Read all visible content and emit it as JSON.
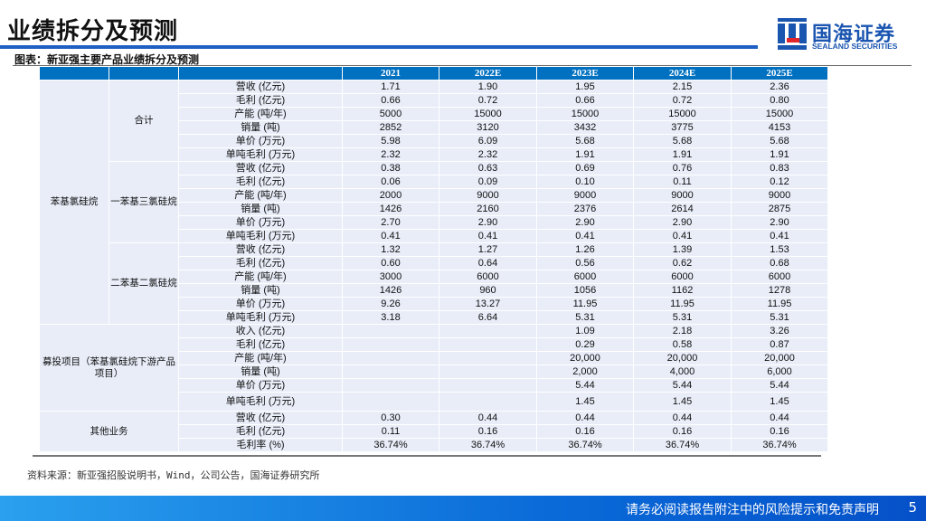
{
  "title": "业绩拆分及预测",
  "logo": {
    "cn": "国海证券",
    "en": "SEALAND SECURITIES"
  },
  "caption": "图表：新亚强主要产品业绩拆分及预测",
  "table": {
    "headers": [
      "",
      "",
      "",
      "2021",
      "2022E",
      "2023E",
      "2024E",
      "2025E"
    ],
    "groups": [
      {
        "name": "苯基氯硅烷",
        "subgroups": [
          {
            "name": "合计",
            "rows": [
              [
                "营收 (亿元)",
                "1.71",
                "1.90",
                "1.95",
                "2.15",
                "2.36"
              ],
              [
                "毛利 (亿元)",
                "0.66",
                "0.72",
                "0.66",
                "0.72",
                "0.80"
              ],
              [
                "产能 (吨/年)",
                "5000",
                "15000",
                "15000",
                "15000",
                "15000"
              ],
              [
                "销量 (吨)",
                "2852",
                "3120",
                "3432",
                "3775",
                "4153"
              ],
              [
                "单价 (万元)",
                "5.98",
                "6.09",
                "5.68",
                "5.68",
                "5.68"
              ],
              [
                "单吨毛利 (万元)",
                "2.32",
                "2.32",
                "1.91",
                "1.91",
                "1.91"
              ]
            ]
          },
          {
            "name": "一苯基三氯硅烷",
            "rows": [
              [
                "营收 (亿元)",
                "0.38",
                "0.63",
                "0.69",
                "0.76",
                "0.83"
              ],
              [
                "毛利 (亿元)",
                "0.06",
                "0.09",
                "0.10",
                "0.11",
                "0.12"
              ],
              [
                "产能 (吨/年)",
                "2000",
                "9000",
                "9000",
                "9000",
                "9000"
              ],
              [
                "销量 (吨)",
                "1426",
                "2160",
                "2376",
                "2614",
                "2875"
              ],
              [
                "单价 (万元)",
                "2.70",
                "2.90",
                "2.90",
                "2.90",
                "2.90"
              ],
              [
                "单吨毛利 (万元)",
                "0.41",
                "0.41",
                "0.41",
                "0.41",
                "0.41"
              ]
            ]
          },
          {
            "name": "二苯基二氯硅烷",
            "rows": [
              [
                "营收 (亿元)",
                "1.32",
                "1.27",
                "1.26",
                "1.39",
                "1.53"
              ],
              [
                "毛利 (亿元)",
                "0.60",
                "0.64",
                "0.56",
                "0.62",
                "0.68"
              ],
              [
                "产能 (吨/年)",
                "3000",
                "6000",
                "6000",
                "6000",
                "6000"
              ],
              [
                "销量 (吨)",
                "1426",
                "960",
                "1056",
                "1162",
                "1278"
              ],
              [
                "单价 (万元)",
                "9.26",
                "13.27",
                "11.95",
                "11.95",
                "11.95"
              ],
              [
                "单吨毛利 (万元)",
                "3.18",
                "6.64",
                "5.31",
                "5.31",
                "5.31"
              ]
            ]
          }
        ]
      },
      {
        "name": "募投项目（苯基氯硅烷下游产品项目）",
        "rows": [
          [
            "收入 (亿元)",
            "",
            "",
            "1.09",
            "2.18",
            "3.26"
          ],
          [
            "毛利 (亿元)",
            "",
            "",
            "0.29",
            "0.58",
            "0.87"
          ],
          [
            "产能 (吨/年)",
            "",
            "",
            "20,000",
            "20,000",
            "20,000"
          ],
          [
            "销量 (吨)",
            "",
            "",
            "2,000",
            "4,000",
            "6,000"
          ],
          [
            "单价 (万元)",
            "",
            "",
            "5.44",
            "5.44",
            "5.44"
          ],
          [
            "单吨毛利 (万元)",
            "",
            "",
            "1.45",
            "1.45",
            "1.45"
          ]
        ]
      },
      {
        "name": "其他业务",
        "rows": [
          [
            "营收 (亿元)",
            "0.30",
            "0.44",
            "0.44",
            "0.44",
            "0.44"
          ],
          [
            "毛利 (亿元)",
            "0.11",
            "0.16",
            "0.16",
            "0.16",
            "0.16"
          ],
          [
            "毛利率 (%)",
            "36.74%",
            "36.74%",
            "36.74%",
            "36.74%",
            "36.74%"
          ]
        ]
      }
    ]
  },
  "source": "资料来源：新亚强招股说明书，Wind，公司公告，国海证券研究所",
  "footer": {
    "disclaimer": "请务必阅读报告附注中的风险提示和免责声明",
    "page": "5"
  }
}
